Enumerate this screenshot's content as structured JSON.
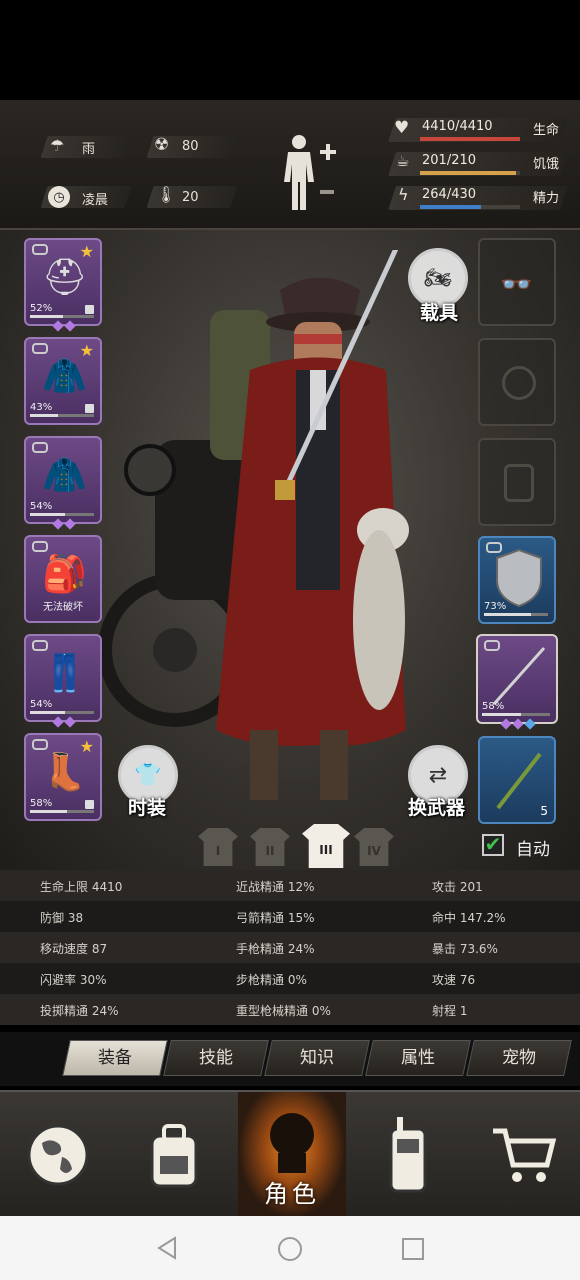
{
  "top_status": {
    "weather": "雨",
    "radiation": "80",
    "time_of_day": "凌晨",
    "temperature": "20"
  },
  "vitals": {
    "health": {
      "value": "4410/4410",
      "label": "生命",
      "fill": 1.0,
      "color": "#c8473c"
    },
    "hunger": {
      "value": "201/210",
      "label": "饥饿",
      "fill": 0.957,
      "color": "#d4a24a"
    },
    "energy": {
      "value": "264/430",
      "label": "精力",
      "fill": 0.614,
      "color": "#3f7fc8"
    }
  },
  "left_slots": [
    {
      "name": "helmet",
      "pct": "52%",
      "durability": 0.52,
      "gems": 2,
      "star": true,
      "lock": true
    },
    {
      "name": "jacket",
      "pct": "43%",
      "durability": 0.43,
      "gems": 0,
      "star": true,
      "lock": true
    },
    {
      "name": "coat",
      "pct": "54%",
      "durability": 0.54,
      "gems": 2,
      "star": false,
      "lock": false
    },
    {
      "name": "backpack",
      "pct": "",
      "durability": 0,
      "gems": 0,
      "star": false,
      "lock": false,
      "note": "无法破坏"
    },
    {
      "name": "pants",
      "pct": "54%",
      "durability": 0.54,
      "gems": 2,
      "star": false,
      "lock": false
    },
    {
      "name": "boots",
      "pct": "58%",
      "durability": 0.58,
      "gems": 0,
      "star": true,
      "lock": true
    }
  ],
  "right_slots": {
    "shield_pct": "73%",
    "shield_durability": 0.73,
    "weapon_pct": "58%",
    "weapon_durability": 0.58,
    "ammo_count": "5"
  },
  "buttons": {
    "vehicle": "载具",
    "fashion": "时装",
    "switch_weapon": "换武器",
    "auto": "自动"
  },
  "loadouts": [
    "I",
    "II",
    "III",
    "IV"
  ],
  "active_loadout": 2,
  "stats": [
    [
      "生命上限 4410",
      "近战精通 12%",
      "攻击 201"
    ],
    [
      "防御 38",
      "弓箭精通 15%",
      "命中 147.2%"
    ],
    [
      "移动速度 87",
      "手枪精通 24%",
      "暴击 73.6%"
    ],
    [
      "闪避率 30%",
      "步枪精通 0%",
      "攻速 76"
    ],
    [
      "投掷精通 24%",
      "重型枪械精通 0%",
      "射程 1"
    ]
  ],
  "tabs": [
    "装备",
    "技能",
    "知识",
    "属性",
    "宠物"
  ],
  "active_tab": 0,
  "bottom_nav": {
    "items": [
      "globe-icon",
      "backpack-icon",
      "character-icon",
      "walkie-talkie-icon",
      "cart-icon"
    ],
    "active_label": "角色"
  }
}
